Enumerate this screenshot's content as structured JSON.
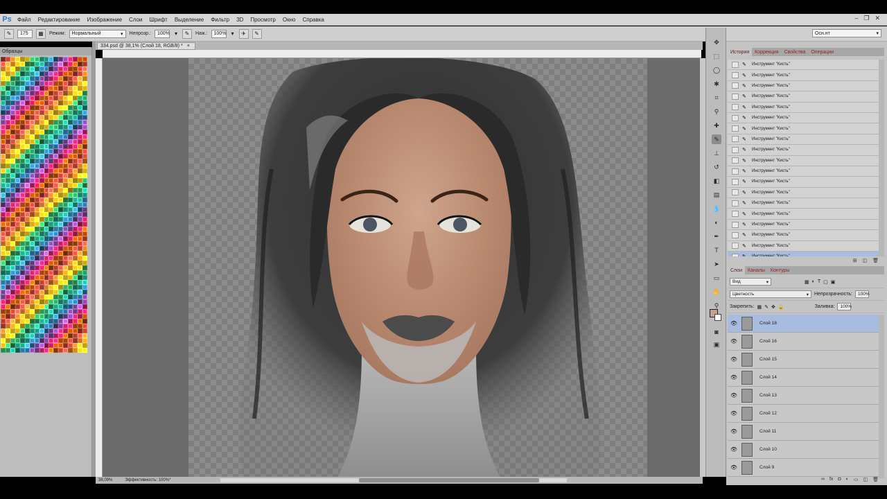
{
  "app": {
    "logo": "Ps"
  },
  "menu": [
    "Файл",
    "Редактирование",
    "Изображение",
    "Слои",
    "Шрифт",
    "Выделение",
    "Фильтр",
    "3D",
    "Просмотр",
    "Окно",
    "Справка"
  ],
  "window_controls": {
    "minimize": "–",
    "restore": "❐",
    "close": "✕"
  },
  "options": {
    "brush_size": "175",
    "mode_label": "Режим:",
    "mode_value": "Нормальный",
    "opacity_label": "Непрозр.:",
    "opacity_value": "100%",
    "flow_label": "Наж.:",
    "flow_value": "100%",
    "workspace": "Осн.нт"
  },
  "swatches": {
    "title": "Образцы",
    "colors": [
      "#c0392b",
      "#e74c3c",
      "#e67e22",
      "#f39c12",
      "#f1c40f",
      "#d4ac0d",
      "#27ae60",
      "#1e8449",
      "#16a085",
      "#138d75",
      "#2e86c1",
      "#1f618d",
      "#6c3483",
      "#8e44ad",
      "#c2185b",
      "#e91e63",
      "#d35400",
      "#a04000"
    ]
  },
  "document": {
    "tab_title": "334.psd @ 38,1% (Слой 18, RGB/8) *",
    "tab_close": "×",
    "zoom": "38,09%",
    "efficiency": "Эффективность: 100%*"
  },
  "history": {
    "tabs": [
      "История",
      "Коррекция",
      "Свойства",
      "Операции"
    ],
    "items": [
      "Инструмент \"Кисть\"",
      "Инструмент \"Кисть\"",
      "Инструмент \"Кисть\"",
      "Инструмент \"Кисть\"",
      "Инструмент \"Кисть\"",
      "Инструмент \"Кисть\"",
      "Инструмент \"Кисть\"",
      "Инструмент \"Кисть\"",
      "Инструмент \"Кисть\"",
      "Инструмент \"Кисть\"",
      "Инструмент \"Кисть\"",
      "Инструмент \"Кисть\"",
      "Инструмент \"Кисть\"",
      "Инструмент \"Кисть\"",
      "Инструмент \"Кисть\"",
      "Инструмент \"Кисть\"",
      "Инструмент \"Кисть\"",
      "Инструмент \"Кисть\"",
      "Инструмент \"Кисть\""
    ]
  },
  "layers": {
    "tabs": [
      "Слои",
      "Каналы",
      "Контуры"
    ],
    "filter_label": "Вид",
    "blend_mode": "Цветность",
    "opacity_label": "Непрозрачность:",
    "opacity_value": "100%",
    "lock_label": "Закрепить:",
    "fill_label": "Заливка:",
    "fill_value": "100%",
    "items": [
      "Слой 18",
      "Слой 16",
      "Слой 15",
      "Слой 14",
      "Слой 13",
      "Слой 12",
      "Слой 11",
      "Слой 10",
      "Слой 9"
    ]
  },
  "colors": {
    "foreground": "#c7a28d",
    "background": "#ffffff",
    "selection": "#a8bcdf"
  }
}
